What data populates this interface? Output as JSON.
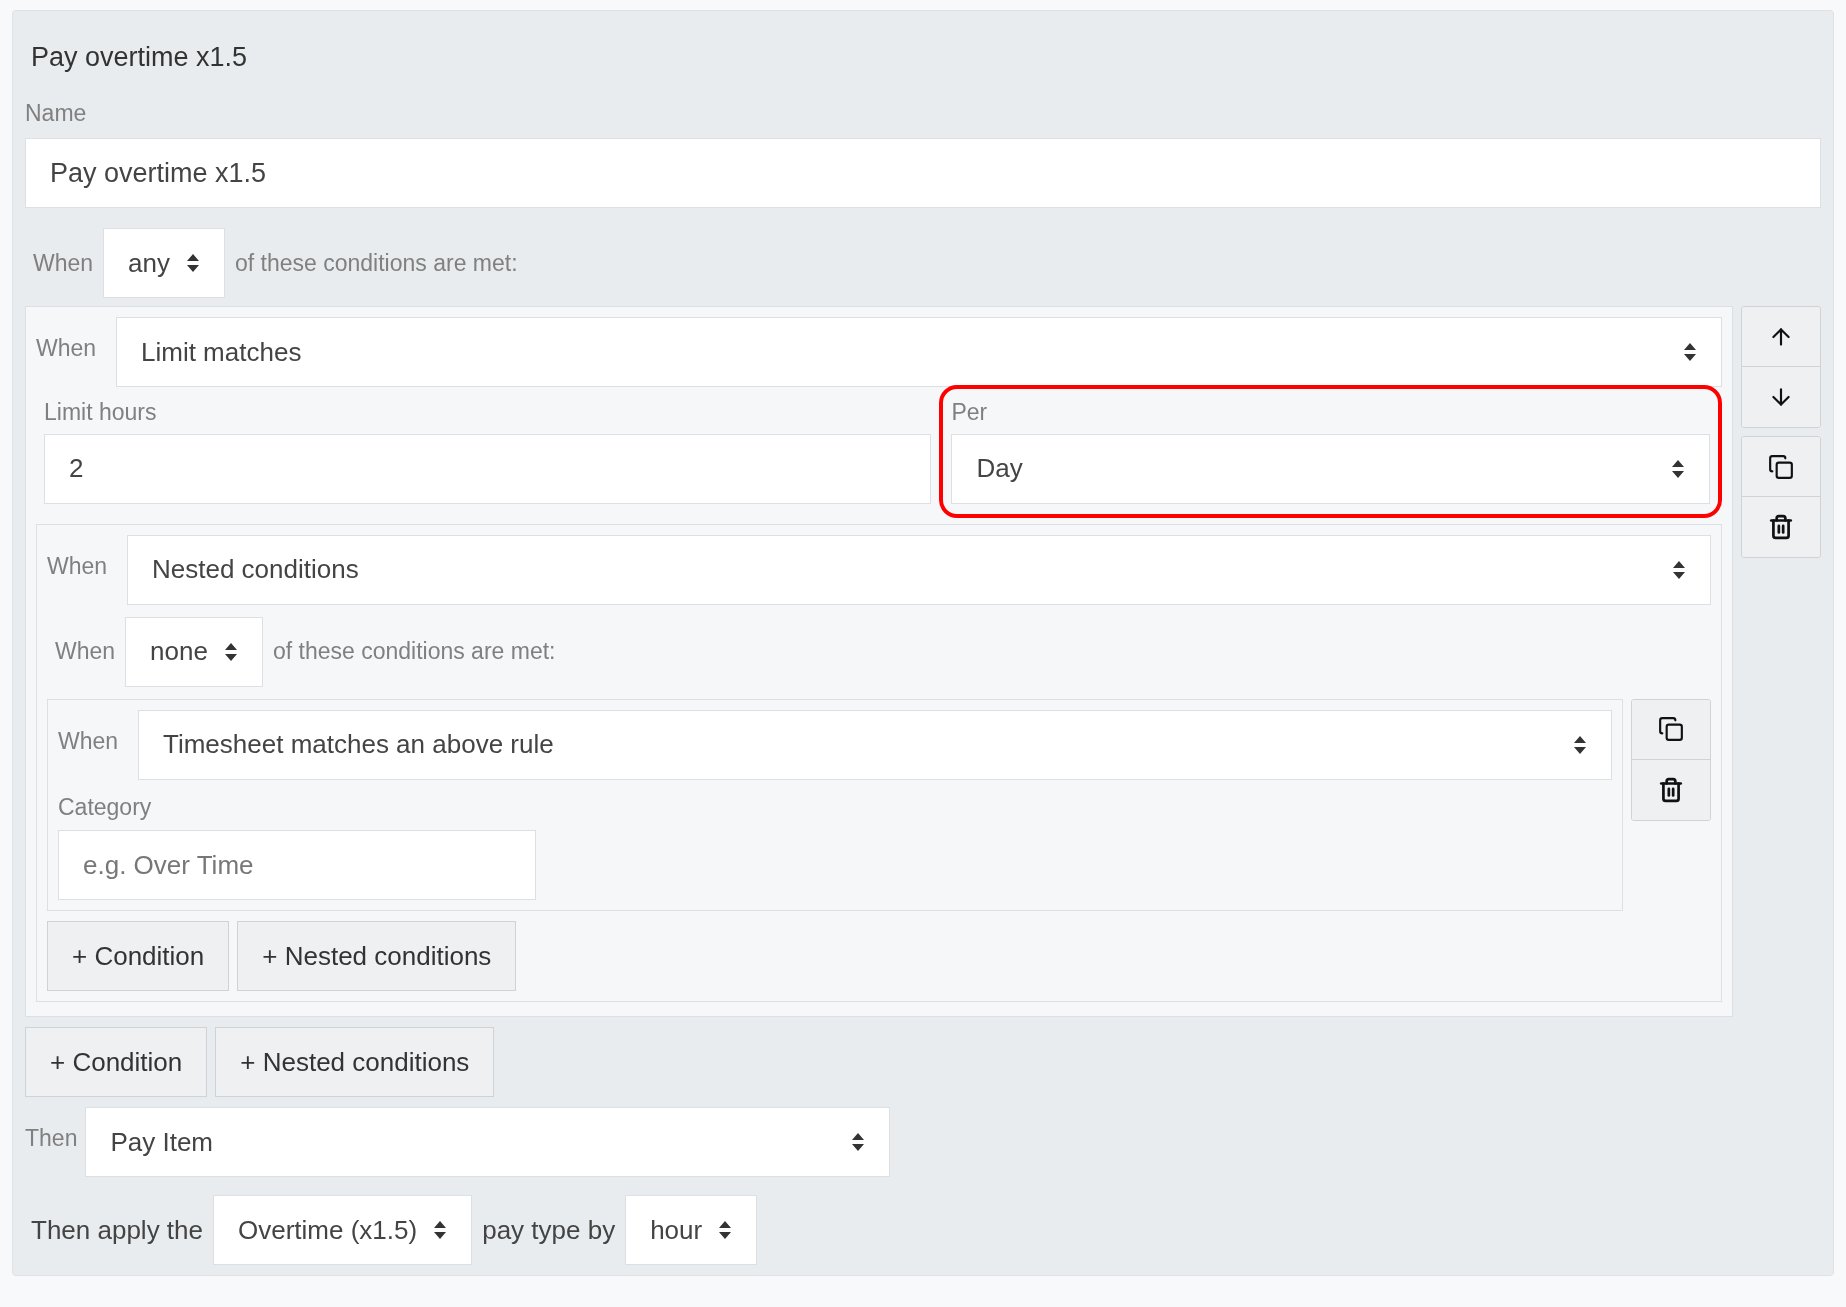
{
  "rule": {
    "title": "Pay overtime x1.5",
    "name_label": "Name",
    "name_value": "Pay overtime x1.5",
    "match": {
      "when_label": "When",
      "quantifier": "any",
      "suffix": "of these conditions are met:"
    },
    "conditions": [
      {
        "kind": "limit",
        "when_label": "When",
        "type": "Limit matches",
        "limit_label": "Limit hours",
        "limit_value": "2",
        "per_label": "Per",
        "per_value": "Day",
        "highlighted": true
      },
      {
        "kind": "nested",
        "when_label": "When",
        "type": "Nested conditions",
        "match": {
          "when_label": "When",
          "quantifier": "none",
          "suffix": "of these conditions are met:"
        },
        "conditions": [
          {
            "kind": "timesheet",
            "when_label": "When",
            "type": "Timesheet matches an above rule",
            "category_label": "Category",
            "category_placeholder": "e.g. Over Time"
          }
        ],
        "add_buttons": [
          "+ Condition",
          "+ Nested conditions"
        ]
      }
    ],
    "add_buttons": [
      "+ Condition",
      "+ Nested conditions"
    ],
    "then": {
      "label": "Then",
      "value": "Pay Item"
    },
    "apply": {
      "prefix": "Then apply the",
      "pay_type": "Overtime (x1.5)",
      "middle": "pay type by",
      "unit": "hour"
    }
  }
}
